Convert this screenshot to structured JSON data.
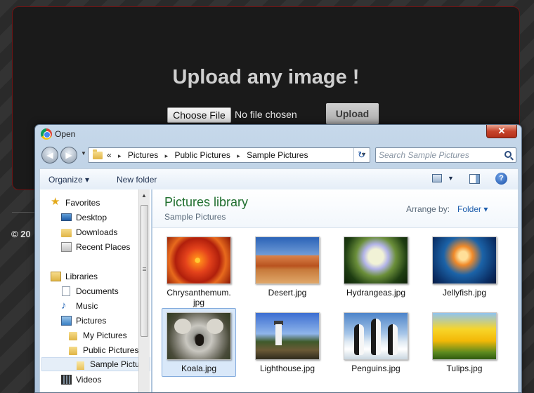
{
  "page": {
    "heading": "Upload any image !",
    "choose_file_label": "Choose File",
    "no_file_text": "No file chosen",
    "upload_label": "Upload",
    "copyright": "© 20"
  },
  "dialog": {
    "title": "Open",
    "close_label": "✕",
    "history_arrow": "▼",
    "breadcrumb": {
      "prefix": "«",
      "items": [
        "Pictures",
        "Public Pictures",
        "Sample Pictures"
      ],
      "separator": "▸"
    },
    "search_placeholder": "Search Sample Pictures",
    "toolbar": {
      "organize": "Organize ▾",
      "new_folder": "New folder",
      "view_menu": "▼",
      "help": "?"
    },
    "nav": {
      "items": [
        {
          "label": "Favorites",
          "icon": "star-icon"
        },
        {
          "label": "Desktop",
          "icon": "desktop-icon"
        },
        {
          "label": "Downloads",
          "icon": "folder-icon"
        },
        {
          "label": "Recent Places",
          "icon": "recent-places-icon"
        },
        {
          "label": "Libraries",
          "icon": "library-icon"
        },
        {
          "label": "Documents",
          "icon": "document-icon"
        },
        {
          "label": "Music",
          "icon": "music-icon"
        },
        {
          "label": "Pictures",
          "icon": "pictures-icon"
        },
        {
          "label": "My Pictures",
          "icon": "folder-icon"
        },
        {
          "label": "Public Pictures",
          "icon": "folder-icon"
        },
        {
          "label": "Sample Pictu",
          "icon": "folder-open-icon"
        },
        {
          "label": "Videos",
          "icon": "video-icon"
        }
      ],
      "scroll_up": "▲"
    },
    "content": {
      "title": "Pictures library",
      "subtitle": "Sample Pictures",
      "arrange_label": "Arrange by:",
      "arrange_value": "Folder ▾",
      "files": [
        {
          "line1": "Chrysanthemum.",
          "line2": "jpg"
        },
        {
          "line1": "Desert.jpg",
          "line2": ""
        },
        {
          "line1": "Hydrangeas.jpg",
          "line2": ""
        },
        {
          "line1": "Jellyfish.jpg",
          "line2": ""
        },
        {
          "line1": "Koala.jpg",
          "line2": ""
        },
        {
          "line1": "Lighthouse.jpg",
          "line2": ""
        },
        {
          "line1": "Penguins.jpg",
          "line2": ""
        },
        {
          "line1": "Tulips.jpg",
          "line2": ""
        }
      ]
    }
  },
  "colors": {
    "panel_border": "#6e1414",
    "library_title": "#1e6e2d",
    "link_blue": "#1f5fae",
    "selection": "#d9e8f9",
    "close_red": "#c7432a"
  }
}
